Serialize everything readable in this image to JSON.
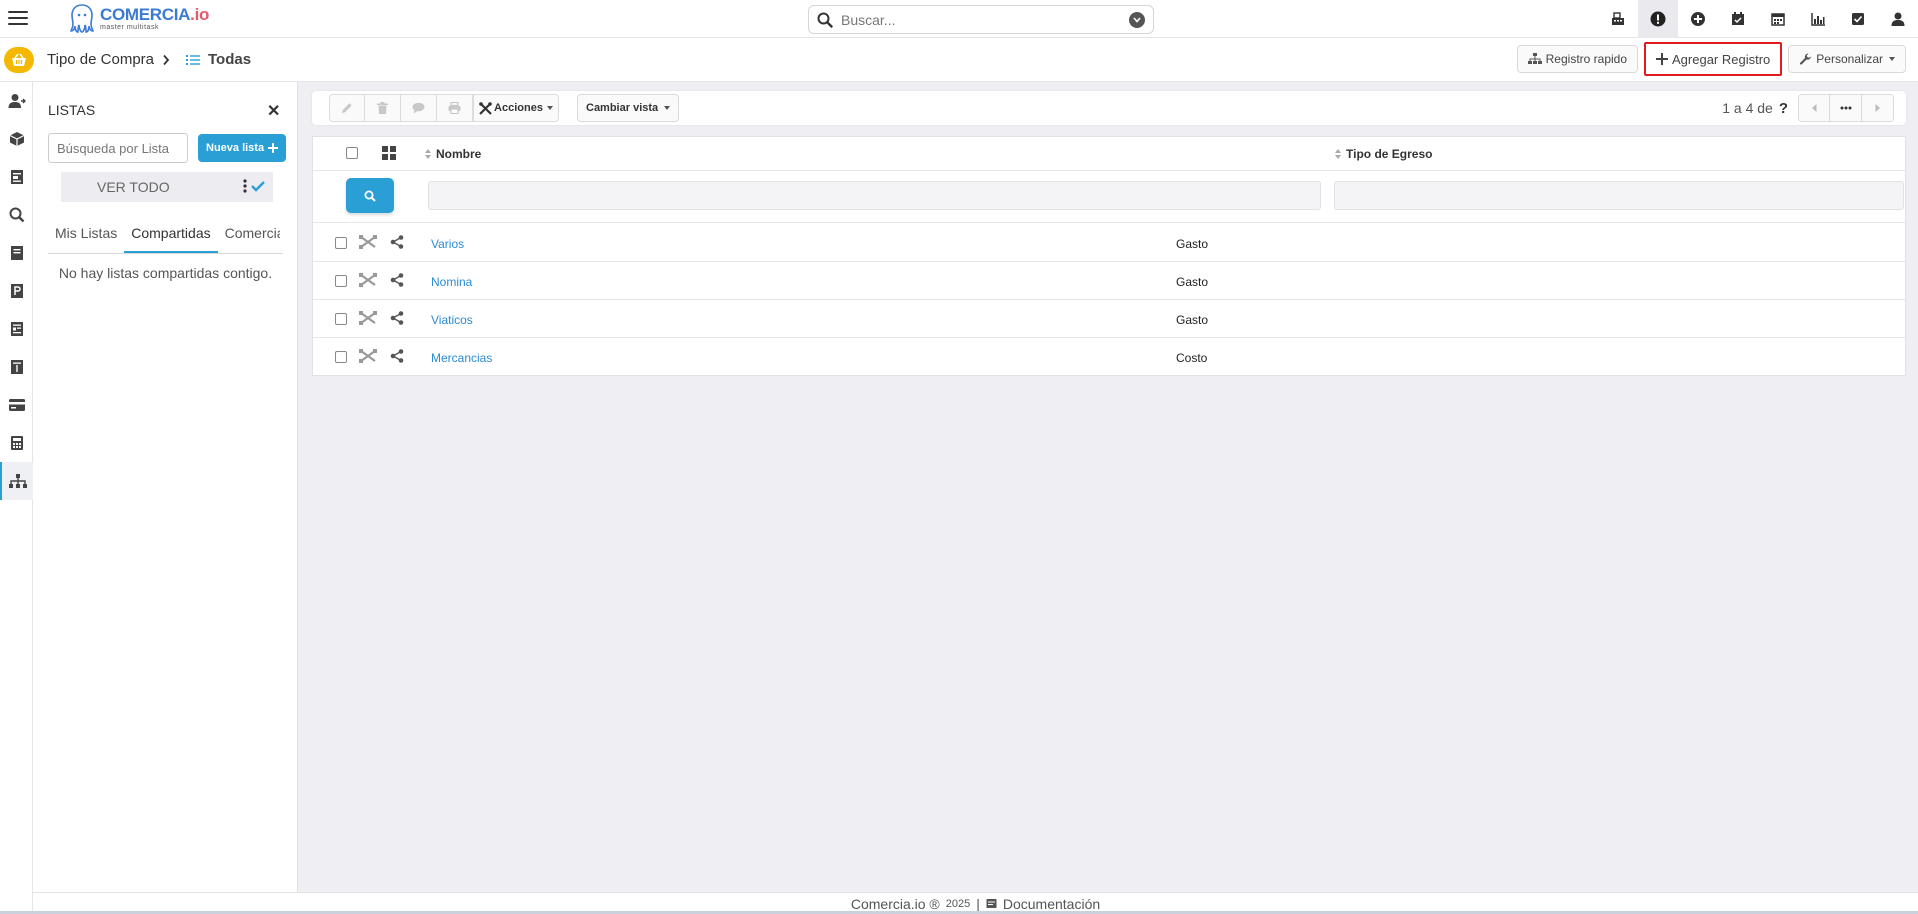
{
  "app": {
    "logo_name": "COMERCIA",
    "logo_suffix": ".io",
    "logo_tagline": "master multitask",
    "search_placeholder": "Buscar..."
  },
  "top_icons": [
    "register-icon",
    "alert-icon",
    "add-circle-icon",
    "calendar-check-icon",
    "calendar-icon",
    "chart-icon",
    "task-check-icon",
    "user-icon"
  ],
  "breadcrumb": {
    "section": "Tipo de Compra",
    "current": "Todas"
  },
  "header_buttons": {
    "registro_rapido": "Registro rapido",
    "agregar_registro": "Agregar Registro",
    "personalizar": "Personalizar"
  },
  "lists_panel": {
    "title": "LISTAS",
    "search_placeholder": "Búsqueda por Lista",
    "new_list": "Nueva lista",
    "view_all": "VER TODO",
    "tabs": [
      "Mis Listas",
      "Compartidas",
      "Comercia"
    ],
    "active_tab": "Compartidas",
    "empty_message": "No hay listas compartidas contigo."
  },
  "toolbar": {
    "actions": "Acciones",
    "change_view": "Cambiar vista",
    "pager_text": "1 a 4  de",
    "pager_unknown": "?"
  },
  "table": {
    "columns": [
      "Nombre",
      "Tipo de Egreso"
    ],
    "rows": [
      {
        "nombre": "Varios",
        "tipo": "Gasto"
      },
      {
        "nombre": "Nomina",
        "tipo": "Gasto"
      },
      {
        "nombre": "Viaticos",
        "tipo": "Gasto"
      },
      {
        "nombre": "Mercancias",
        "tipo": "Costo"
      }
    ]
  },
  "footer": {
    "brand": "Comercia.io ®",
    "year": "2025",
    "separator": "|",
    "docs": "Documentación"
  },
  "colors": {
    "accent": "#2a9fd6",
    "link": "#2a8bd6",
    "highlight_border": "#e01b1b",
    "basket": "#f5b800",
    "background": "#eeeef3"
  }
}
